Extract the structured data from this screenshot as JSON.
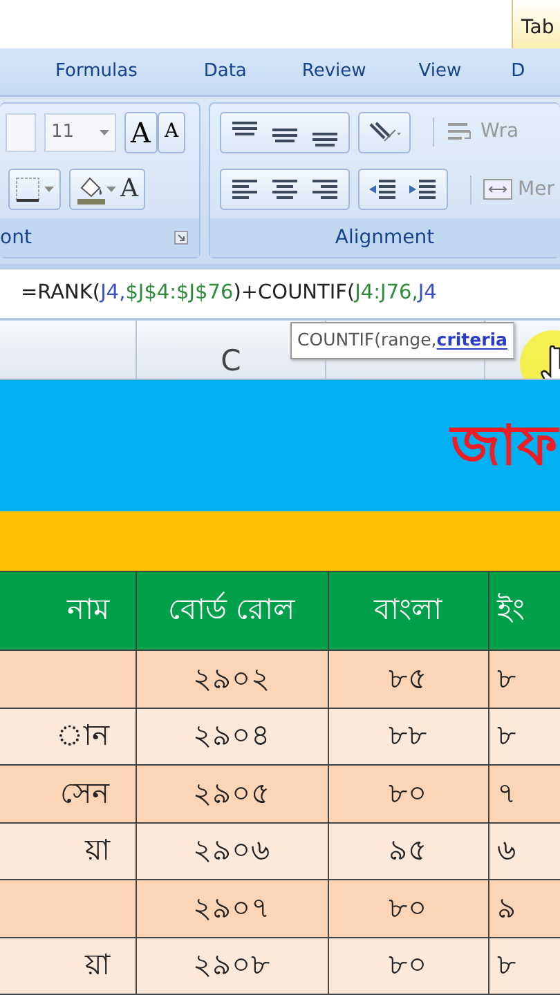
{
  "contextual_tab": {
    "label": "Tab"
  },
  "ribbon_tabs": [
    {
      "label": "Formulas",
      "selected": false
    },
    {
      "label": "Data",
      "selected": false
    },
    {
      "label": "Review",
      "selected": false
    },
    {
      "label": "View",
      "selected": false
    },
    {
      "label": "D",
      "selected": false
    }
  ],
  "font_group": {
    "label": "ont",
    "font_size": "11",
    "grow_font": "A",
    "shrink_font": "A",
    "font_color": "A"
  },
  "alignment_group": {
    "label": "Alignment",
    "wrap_text": "Wra",
    "merge": "Mer"
  },
  "formula_bar": {
    "segments": [
      {
        "text": "=RANK(",
        "color": "#222222"
      },
      {
        "text": "J4,",
        "color": "#3a4fc0"
      },
      {
        "text": "$J$4:$J$76",
        "color": "#2e8b3a"
      },
      {
        "text": ")+COUNTIF(",
        "color": "#222222"
      },
      {
        "text": "J4:J76,",
        "color": "#2e8b3a"
      },
      {
        "text": "J4",
        "color": "#3a4fc0"
      }
    ]
  },
  "tooltip": {
    "text": "COUNTIF(range, ",
    "current_argument": "criteria"
  },
  "column_headers": [
    {
      "label": "C"
    }
  ],
  "title_band": {
    "text": "জাফ"
  },
  "table": {
    "columns": [
      "নাম",
      "বোর্ড রোল",
      "বাংলা",
      "ইং"
    ],
    "rows": [
      [
        "",
        "২৯০২",
        "৮৫",
        "৮"
      ],
      [
        "ান",
        "২৯০৪",
        "৮৮",
        "৮"
      ],
      [
        "সেন",
        "২৯০৫",
        "৮০",
        "৭"
      ],
      [
        "য়া",
        "২৯০৬",
        "৯৫",
        "৬"
      ],
      [
        "",
        "২৯০৭",
        "৮০",
        "৯"
      ],
      [
        "য়া",
        "২৯০৮",
        "৮০",
        "৮"
      ]
    ]
  }
}
